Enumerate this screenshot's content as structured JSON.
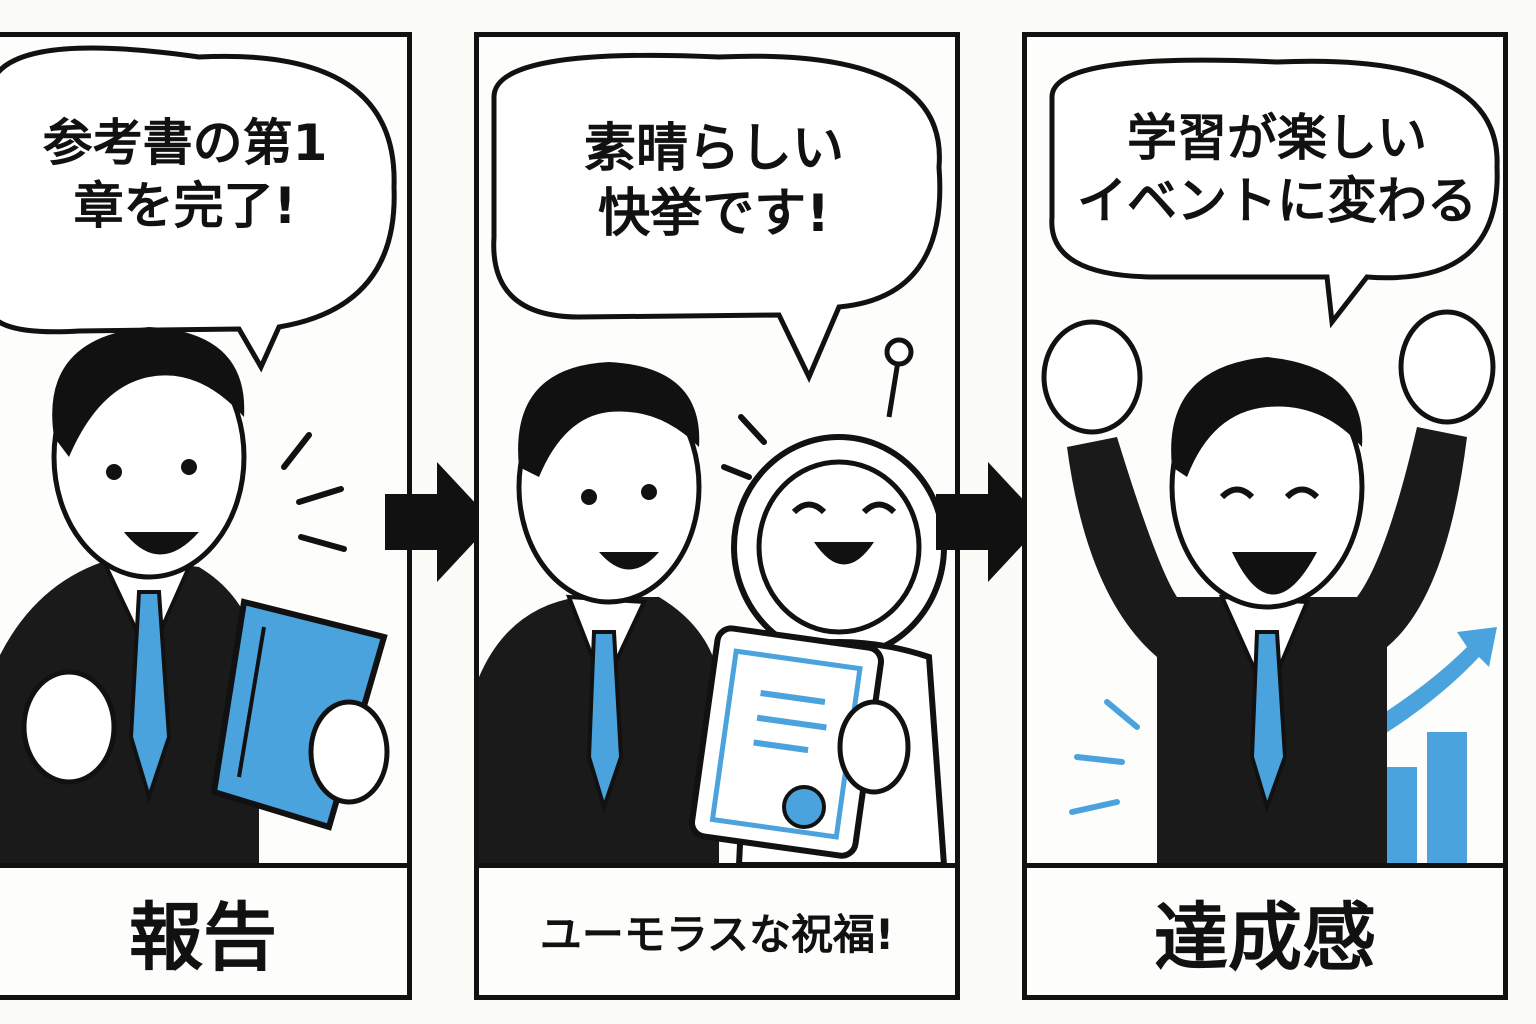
{
  "panels": [
    {
      "speech": [
        "参考書の第1",
        "章を完了!"
      ],
      "caption": "報告"
    },
    {
      "speech": [
        "素晴らしい",
        "快挙です!"
      ],
      "caption": "ユーモラスな祝福!"
    },
    {
      "speech": [
        "学習が楽しい",
        "イベントに変わる"
      ],
      "caption": "達成感"
    }
  ],
  "colors": {
    "ink": "#111111",
    "accent_blue": "#4aa3dc",
    "paper": "#fdfdfb"
  },
  "icons": [
    "arrow-right-icon",
    "book-icon",
    "robot-icon",
    "certificate-icon",
    "growth-chart-icon"
  ]
}
